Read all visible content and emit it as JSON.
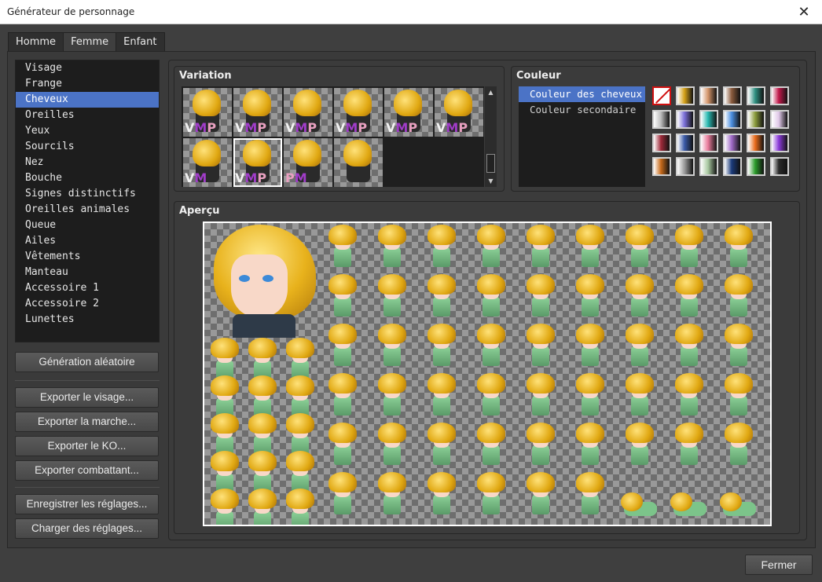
{
  "window": {
    "title": "Générateur de personnage",
    "close_icon": "close-icon"
  },
  "tabs": [
    {
      "label": "Homme",
      "active": false
    },
    {
      "label": "Femme",
      "active": true
    },
    {
      "label": "Enfant",
      "active": false
    }
  ],
  "parts": {
    "items": [
      "Visage",
      "Frange",
      "Cheveux",
      "Oreilles",
      "Yeux",
      "Sourcils",
      "Nez",
      "Bouche",
      "Signes distinctifs",
      "Oreilles animales",
      "Queue",
      "Ailes",
      "Vêtements",
      "Manteau",
      "Accessoire 1",
      "Accessoire 2",
      "Lunettes"
    ],
    "selected": "Cheveux"
  },
  "buttons": {
    "random": "Génération aléatoire",
    "export_face": "Exporter le visage...",
    "export_walk": "Exporter la marche...",
    "export_ko": "Exporter le KO...",
    "export_battler": "Exporter combattant...",
    "save_settings": "Enregistrer les réglages...",
    "load_settings": "Charger des réglages...",
    "close": "Fermer"
  },
  "variation": {
    "label": "Variation",
    "selected_index": 7,
    "cells": [
      {
        "marks": "VMP"
      },
      {
        "marks": "VMP"
      },
      {
        "marks": "VMP"
      },
      {
        "marks": "VMP"
      },
      {
        "marks": "VMP"
      },
      {
        "marks": "VMP"
      },
      {
        "marks": "VM"
      },
      {
        "marks": "VMP"
      },
      {
        "marks": "PM"
      },
      {
        "marks": ""
      }
    ]
  },
  "color": {
    "label": "Couleur",
    "targets": [
      "Couleur des cheveux",
      "Couleur secondaire"
    ],
    "selected_target": "Couleur des cheveux",
    "swatches": [
      [
        "#ffffff",
        "#d4a017",
        "#d4956a",
        "#8a5a3c",
        "#2e8f80",
        "#c0184a"
      ],
      [
        "#bdbdbd",
        "#7a6fd8",
        "#27b8b0",
        "#4a8ee0",
        "#8a9a3a",
        "#e0c8e8"
      ],
      [
        "#a02a3a",
        "#3a5aa8",
        "#e87a9a",
        "#a06ac8",
        "#e86a1a",
        "#8a3ad8"
      ],
      [
        "#c86a1a",
        "#9a9a9a",
        "#a8c8a0",
        "#1a3a7a",
        "#2a9a2a",
        "#2a2a2a"
      ]
    ]
  },
  "preview": {
    "label": "Aperçu"
  }
}
